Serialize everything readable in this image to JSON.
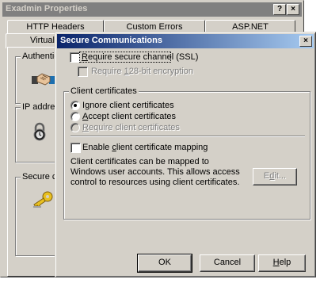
{
  "background_window": {
    "title": "Exadmin Properties",
    "help_glyph": "?",
    "close_glyph": "×",
    "tabs": {
      "http_headers": "HTTP Headers",
      "custom_errors": "Custom Errors",
      "aspnet": "ASP.NET",
      "virtual": "Virtual D"
    },
    "groups": {
      "authentication": "Authenticat",
      "ip_address": "IP address",
      "secure_comm": "Secure com"
    },
    "icons": [
      "handshake-icon",
      "padlock-icon",
      "key-icon"
    ]
  },
  "dialog": {
    "title": "Secure Communications",
    "close_glyph": "×",
    "require_ssl": {
      "label_pre": "",
      "label_ul": "R",
      "label_post": "equire secure channel (SSL)",
      "checked": false
    },
    "require_128": {
      "label_pre": "Require ",
      "label_ul": "1",
      "label_post": "28-bit encryption",
      "checked": false,
      "disabled": true
    },
    "client_certificates": {
      "group_label": "Client certificates",
      "options": [
        {
          "pre": "I",
          "ul": "g",
          "post": "nore client certificates",
          "selected": true,
          "disabled": false
        },
        {
          "pre": "",
          "ul": "A",
          "post": "ccept client certificates",
          "selected": false,
          "disabled": false
        },
        {
          "pre": "",
          "ul": "R",
          "post": "equire client certificates",
          "selected": false,
          "disabled": true
        }
      ],
      "mapping": {
        "label_pre": "Enable ",
        "label_ul": "c",
        "label_post": "lient certificate mapping",
        "checked": false
      },
      "mapping_description": "Client certificates can be mapped to Windows user accounts.  This allows access control to resources using client certificates.",
      "edit_button": {
        "pre": "E",
        "ul": "d",
        "post": "it..."
      }
    },
    "buttons": {
      "ok": "OK",
      "cancel": "Cancel",
      "help_ul": "H",
      "help_post": "elp"
    }
  },
  "colors": {
    "face": "#d4d0c8",
    "active_title_start": "#0a246a",
    "active_title_end": "#a6caf0",
    "inactive_title": "#808080"
  }
}
